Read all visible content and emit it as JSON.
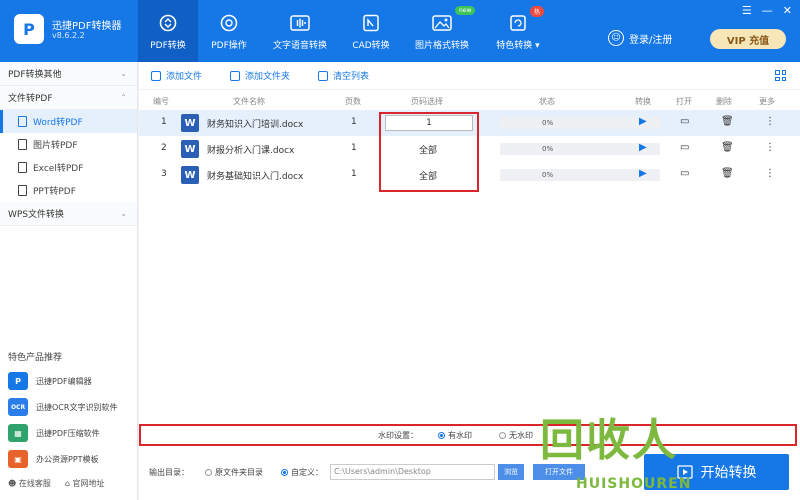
{
  "header": {
    "logo_letter": "P",
    "app_name": "迅捷PDF转换器",
    "version": "v8.6.2.2",
    "tabs": [
      {
        "label": "PDF转换",
        "active": true
      },
      {
        "label": "PDF操作"
      },
      {
        "label": "文字语音转换"
      },
      {
        "label": "CAD转换"
      },
      {
        "label": "图片格式转换",
        "badge": "new"
      },
      {
        "label": "特色转换",
        "badge": "热"
      }
    ],
    "dropdown": "▾",
    "login": "登录/注册",
    "vip": "VIP 充值",
    "win_controls": [
      "☰",
      "—",
      "✕"
    ]
  },
  "sidebar": {
    "groups": [
      {
        "label": "PDF转换其他",
        "chevron": "⌄"
      },
      {
        "label": "文件转PDF",
        "chevron": "⌃"
      }
    ],
    "items": [
      {
        "label": "Word转PDF",
        "active": true
      },
      {
        "label": "图片转PDF"
      },
      {
        "label": "Excel转PDF"
      },
      {
        "label": "PPT转PDF"
      }
    ],
    "group_wps": {
      "label": "WPS文件转换",
      "chevron": "⌄"
    },
    "featured_title": "特色产品推荐",
    "featured": [
      {
        "label": "迅捷PDF编辑器",
        "icon": "P",
        "color": "#1677e6"
      },
      {
        "label": "迅捷OCR文字识别软件",
        "icon": "OCR",
        "color": "#2b7de9"
      },
      {
        "label": "迅捷PDF压缩软件",
        "icon": "▦",
        "color": "#2fa36b"
      },
      {
        "label": "办公资源PPT模板",
        "icon": "▣",
        "color": "#e8632b"
      }
    ],
    "bottom": [
      "在线客服",
      "官网地址"
    ]
  },
  "toolbar": {
    "add_file": "添加文件",
    "add_folder": "添加文件夹",
    "clear_list": "清空列表"
  },
  "table": {
    "headers": [
      "编号",
      "文件名称",
      "页数",
      "页码选择",
      "状态",
      "转换",
      "打开",
      "删除",
      "更多"
    ],
    "rows": [
      {
        "no": "1",
        "name": "财务知识入门培训.docx",
        "pages": "1",
        "range": "1",
        "status": "0%",
        "selected": true
      },
      {
        "no": "2",
        "name": "财报分析入门课.docx",
        "pages": "1",
        "range": "全部",
        "status": "0%"
      },
      {
        "no": "3",
        "name": "财务基础知识入门.docx",
        "pages": "1",
        "range": "全部",
        "status": "0%"
      }
    ],
    "file_icon": "W",
    "actions": {
      "convert": "▶",
      "open": "▭",
      "delete": "🗑",
      "more": "⋮"
    }
  },
  "watermark": {
    "label": "水印设置：",
    "option_with": "有水印",
    "option_without": "无水印"
  },
  "output": {
    "label": "输出目录：",
    "option_original": "原文件夹目录",
    "option_custom": "自定义：",
    "path": "C:\\Users\\admin\\Desktop",
    "browse": "浏览",
    "open_folder": "打开文件",
    "start": "开始转换"
  },
  "brand": {
    "main": "回收人",
    "sub": "HUISHOUREN"
  },
  "colors": {
    "primary": "#1677e6",
    "highlight": "#d9262c",
    "brand": "#7cb93e"
  }
}
